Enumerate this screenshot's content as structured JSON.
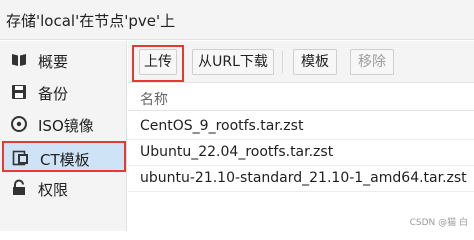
{
  "window": {
    "title": "存储'local'在节点'pve'上"
  },
  "sidebar": {
    "items": [
      {
        "label": "概要",
        "icon": "book-icon"
      },
      {
        "label": "备份",
        "icon": "floppy-disk-icon"
      },
      {
        "label": "ISO镜像",
        "icon": "disc-icon"
      },
      {
        "label": "CT模板",
        "icon": "template-icon"
      },
      {
        "label": "权限",
        "icon": "lock-icon"
      }
    ],
    "selected": "CT模板"
  },
  "toolbar": {
    "upload_label": "上传",
    "download_url_label": "从URL下载",
    "templates_label": "模板",
    "remove_label": "移除"
  },
  "grid": {
    "column_header": "名称",
    "rows": [
      "CentOS_9_rootfs.tar.zst",
      "Ubuntu_22.04_rootfs.tar.zst",
      "ubuntu-21.10-standard_21.10-1_amd64.tar.zst"
    ]
  },
  "watermark": "CSDN @猫 白",
  "colors": {
    "highlight_border": "#e53935",
    "selected_background": "#cfe3f6"
  }
}
